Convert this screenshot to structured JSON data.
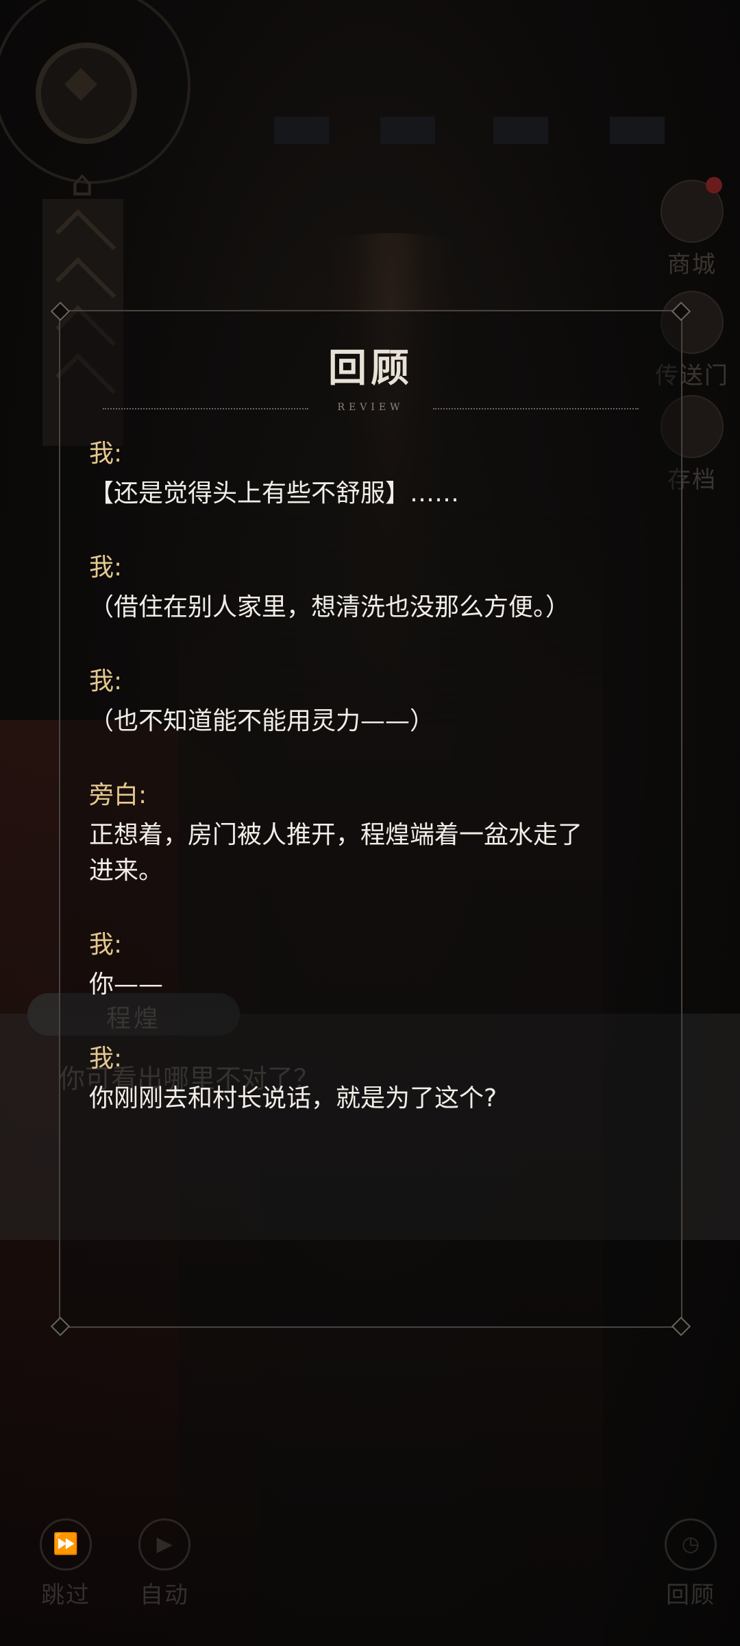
{
  "background": {
    "speaker_name": "程煌",
    "dialog_line": "你可看出哪里不对了？"
  },
  "side_menu": {
    "shop_label": "商城",
    "portal_label": "传送门",
    "save_label": "存档"
  },
  "bottom_controls": {
    "skip_label": "跳过",
    "auto_label": "自动",
    "review_label": "回顾"
  },
  "review": {
    "title": "回顾",
    "subtitle": "REVIEW",
    "entries": [
      {
        "speaker": "我:",
        "text": "【还是觉得头上有些不舒服】……"
      },
      {
        "speaker": "我:",
        "text": "（借住在别人家里，想清洗也没那么方便。）"
      },
      {
        "speaker": "我:",
        "text": "（也不知道能不能用灵力——）"
      },
      {
        "speaker": "旁白:",
        "text": "正想着，房门被人推开，程煌端着一盆水走了\n进来。"
      },
      {
        "speaker": "我:",
        "text": "你——"
      },
      {
        "speaker": "我:",
        "text": "你刚刚去和村长说话，就是为了这个?"
      }
    ]
  },
  "colors": {
    "speaker": "#e6c88f",
    "text": "#f1ede7",
    "frame": "#4a4440"
  },
  "icons": [
    "home-icon",
    "chevron-icon",
    "shop-avatar-icon",
    "portal-icon",
    "cloud-save-icon",
    "fast-forward-icon",
    "play-icon",
    "clock-icon"
  ]
}
